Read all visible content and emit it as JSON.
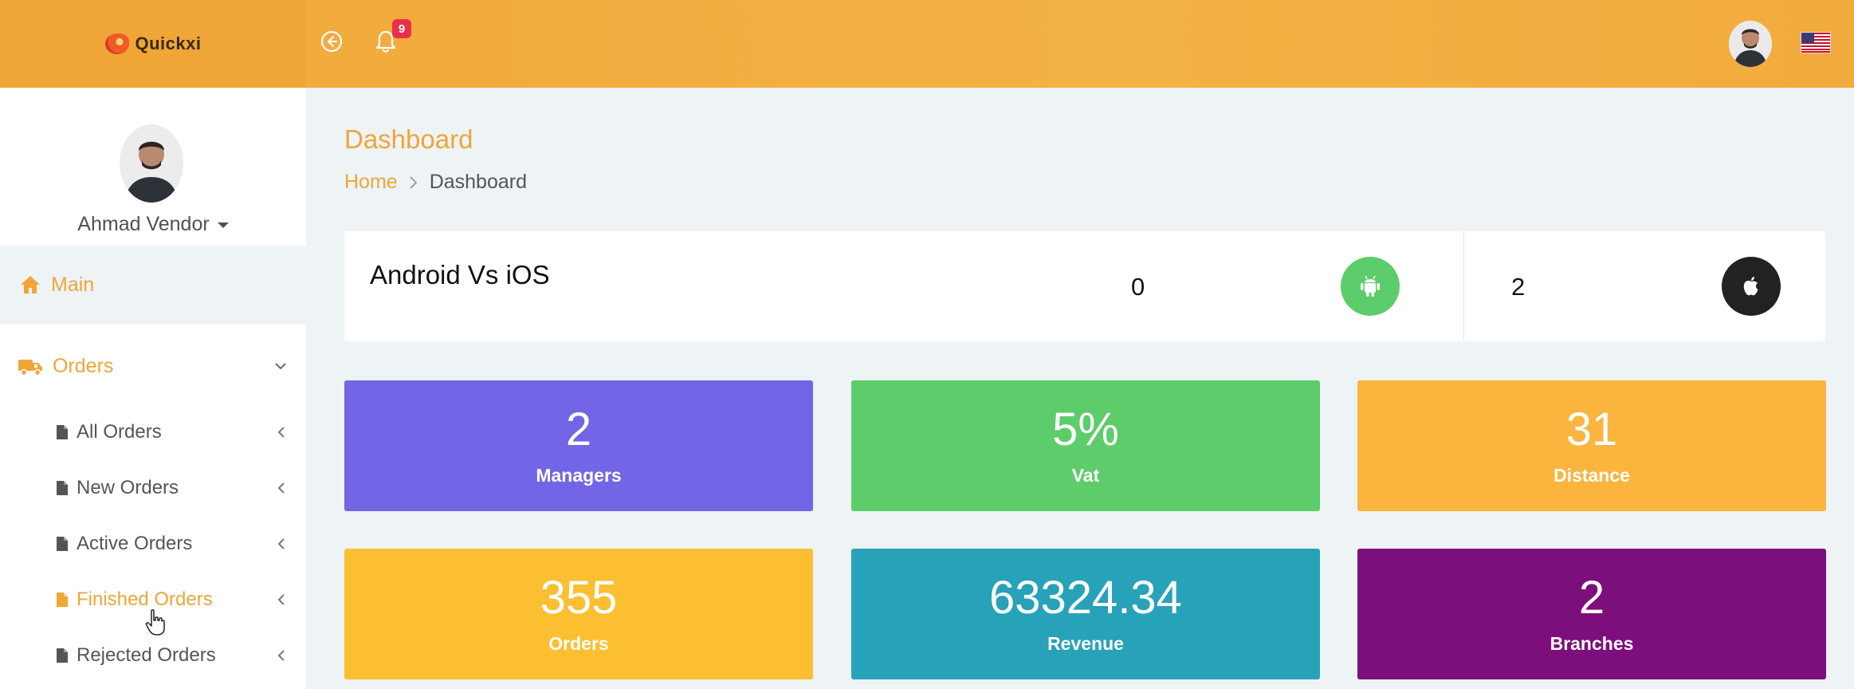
{
  "app": {
    "brand_name": "Quickxi",
    "notification_count": "9"
  },
  "user": {
    "name": "Ahmad Vendor"
  },
  "sidebar": {
    "main_label": "Main",
    "orders_label": "Orders",
    "sub_items": [
      {
        "label": "All Orders"
      },
      {
        "label": "New Orders"
      },
      {
        "label": "Active Orders"
      },
      {
        "label": "Finished Orders"
      },
      {
        "label": "Rejected Orders"
      }
    ]
  },
  "page": {
    "title": "Dashboard",
    "breadcrumb": {
      "home": "Home",
      "current": "Dashboard"
    }
  },
  "devices": {
    "title": "Android Vs iOS",
    "android_count": "0",
    "ios_count": "2"
  },
  "stats": [
    {
      "value": "2",
      "label": "Managers",
      "color": "#7366e6"
    },
    {
      "value": "5%",
      "label": "Vat",
      "color": "#5dcc6a"
    },
    {
      "value": "31",
      "label": "Distance",
      "color": "#fbb53e"
    },
    {
      "value": "355",
      "label": "Orders",
      "color": "#fbbf31"
    },
    {
      "value": "63324.34",
      "label": "Revenue",
      "color": "#27a2b8"
    },
    {
      "value": "2",
      "label": "Branches",
      "color": "#7d0f7d"
    }
  ],
  "icons": {
    "back": "arrow-left-circle-icon",
    "notification": "bell-icon",
    "language": "us-flag-icon",
    "android": "android-icon",
    "ios": "apple-icon"
  },
  "colors": {
    "accent": "#efa637",
    "android": "#5dcc6a",
    "ios": "#222222"
  }
}
